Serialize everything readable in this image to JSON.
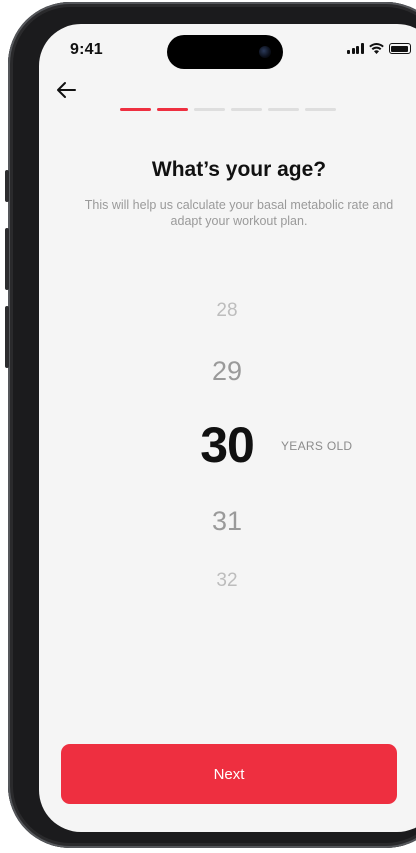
{
  "status_bar": {
    "time": "9:41",
    "icons": [
      "signal-icon",
      "wifi-icon",
      "battery-icon"
    ]
  },
  "nav": {
    "back_icon": "back-arrow-icon"
  },
  "progress": {
    "total_steps": 6,
    "completed_steps": 2,
    "active_color": "#ee2f40",
    "inactive_color": "#dedede"
  },
  "header": {
    "title": "What’s your age?",
    "subtitle": "This will help us calculate your basal metabolic rate and adapt your workout plan."
  },
  "picker": {
    "options": [
      "28",
      "29",
      "30",
      "31",
      "32"
    ],
    "selected": "30",
    "unit_label": "YEARS OLD"
  },
  "footer": {
    "next_label": "Next",
    "accent_color": "#ee2f40"
  }
}
